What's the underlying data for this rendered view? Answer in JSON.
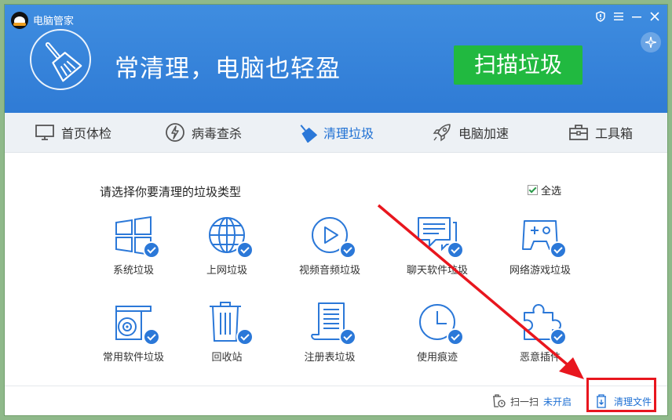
{
  "window": {
    "title": "电脑管家",
    "controls": [
      "shield-icon",
      "menu-icon",
      "minimize-icon",
      "close-icon"
    ]
  },
  "banner": {
    "slogan": "常清理，电脑也轻盈",
    "scan_button": "扫描垃圾",
    "scan_button_color": "#21b940"
  },
  "nav": {
    "items": [
      {
        "label": "首页体检",
        "icon": "monitor-icon"
      },
      {
        "label": "病毒查杀",
        "icon": "lightning-shield-icon"
      },
      {
        "label": "清理垃圾",
        "icon": "broom-icon",
        "active": true
      },
      {
        "label": "电脑加速",
        "icon": "rocket-icon"
      },
      {
        "label": "工具箱",
        "icon": "toolbox-icon"
      }
    ]
  },
  "content": {
    "title": "请选择你要清理的垃圾类型",
    "select_all": "全选",
    "categories": [
      {
        "label": "系统垃圾",
        "icon": "windows-icon",
        "checked": true
      },
      {
        "label": "上网垃圾",
        "icon": "globe-icon",
        "checked": true
      },
      {
        "label": "视频音频垃圾",
        "icon": "play-icon",
        "checked": true
      },
      {
        "label": "聊天软件垃圾",
        "icon": "chat-icon",
        "checked": true
      },
      {
        "label": "网络游戏垃圾",
        "icon": "gamepad-icon",
        "checked": true
      },
      {
        "label": "常用软件垃圾",
        "icon": "disc-drive-icon",
        "checked": true
      },
      {
        "label": "回收站",
        "icon": "trash-icon",
        "checked": true
      },
      {
        "label": "注册表垃圾",
        "icon": "scroll-icon",
        "checked": true
      },
      {
        "label": "使用痕迹",
        "icon": "clock-icon",
        "checked": true
      },
      {
        "label": "恶意插件",
        "icon": "puzzle-icon",
        "checked": true
      }
    ]
  },
  "footer": {
    "scan_label": "扫一扫",
    "scan_status": "未开启",
    "clean_files": "清理文件"
  },
  "accent_color": "#2b78d8",
  "annotation_color": "#e8161e"
}
